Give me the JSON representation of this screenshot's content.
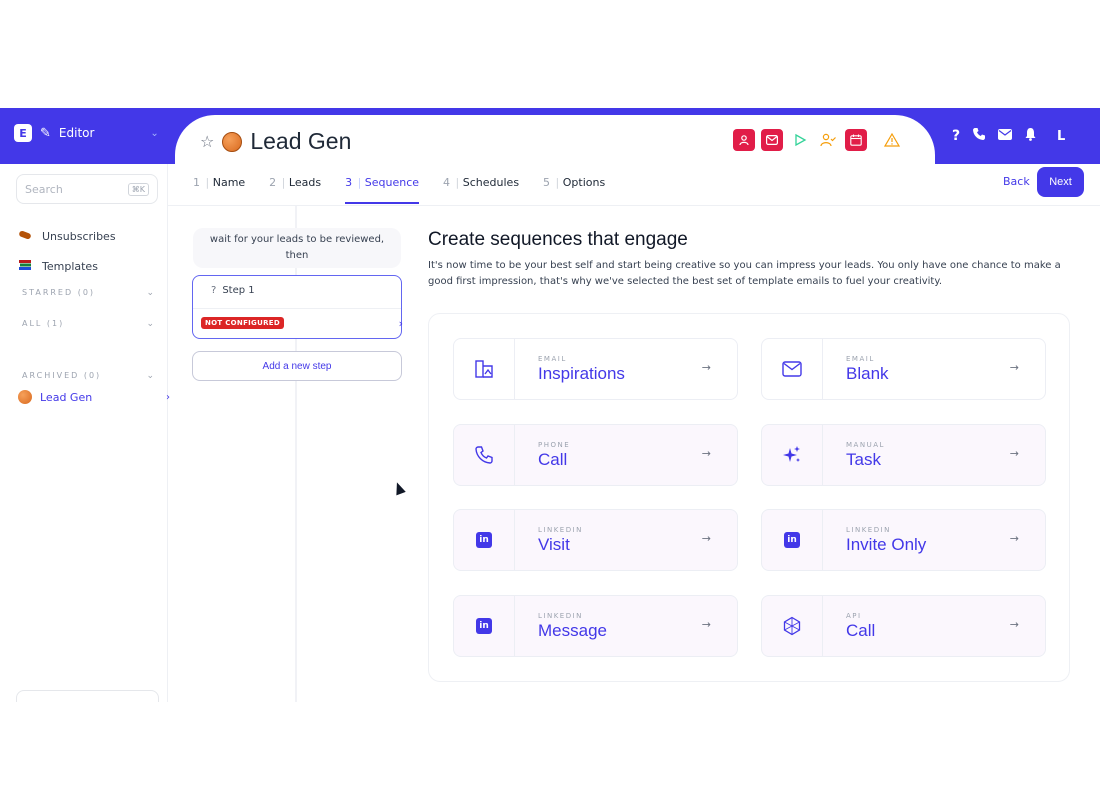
{
  "header": {
    "logo_letter": "E",
    "mode_label": "Editor",
    "page_title": "Lead Gen",
    "user_initial": "L",
    "brand_color": "#4338e8",
    "toolbar_icons": [
      "linkedin-contact-icon",
      "email-icon",
      "play-icon",
      "user-check-icon",
      "calendar-icon",
      "warning-icon"
    ],
    "right_icons": [
      "help-icon",
      "phone-icon",
      "mail-icon",
      "bell-icon"
    ]
  },
  "sidebar": {
    "search_placeholder": "Search",
    "search_shortcut": "⌘K",
    "unsubscribes_label": "Unsubscribes",
    "templates_label": "Templates",
    "starred_label": "STARRED (0)",
    "all_label": "ALL (1)",
    "campaign_label": "Lead Gen",
    "archived_label": "ARCHIVED (0)"
  },
  "tabs": [
    {
      "num": "1",
      "label": "Name"
    },
    {
      "num": "2",
      "label": "Leads"
    },
    {
      "num": "3",
      "label": "Sequence"
    },
    {
      "num": "4",
      "label": "Schedules"
    },
    {
      "num": "5",
      "label": "Options"
    }
  ],
  "actions": {
    "back": "Back",
    "next": "Next"
  },
  "steps": {
    "wait_text_line1": "wait for your leads to be reviewed,",
    "wait_text_line2": "then",
    "step1_label": "Step 1",
    "step1_status": "NOT CONFIGURED",
    "add_step": "Add a new step"
  },
  "content": {
    "title": "Create sequences that engage",
    "description": "It's now time to be your best self and start being creative so you can impress your leads. You only have one chance to make a good first impression, that's why we've selected the best set of template emails to fuel your creativity."
  },
  "options": [
    {
      "kicker": "EMAIL",
      "label": "Inspirations",
      "icon": "template-icon"
    },
    {
      "kicker": "EMAIL",
      "label": "Blank",
      "icon": "envelope-icon"
    },
    {
      "kicker": "PHONE",
      "label": "Call",
      "icon": "phone-icon"
    },
    {
      "kicker": "MANUAL",
      "label": "Task",
      "icon": "sparkle-icon"
    },
    {
      "kicker": "LINKEDIN",
      "label": "Visit",
      "icon": "linkedin-icon"
    },
    {
      "kicker": "LINKEDIN",
      "label": "Invite Only",
      "icon": "linkedin-icon"
    },
    {
      "kicker": "LINKEDIN",
      "label": "Message",
      "icon": "linkedin-icon"
    },
    {
      "kicker": "API",
      "label": "Call",
      "icon": "api-icon"
    }
  ]
}
